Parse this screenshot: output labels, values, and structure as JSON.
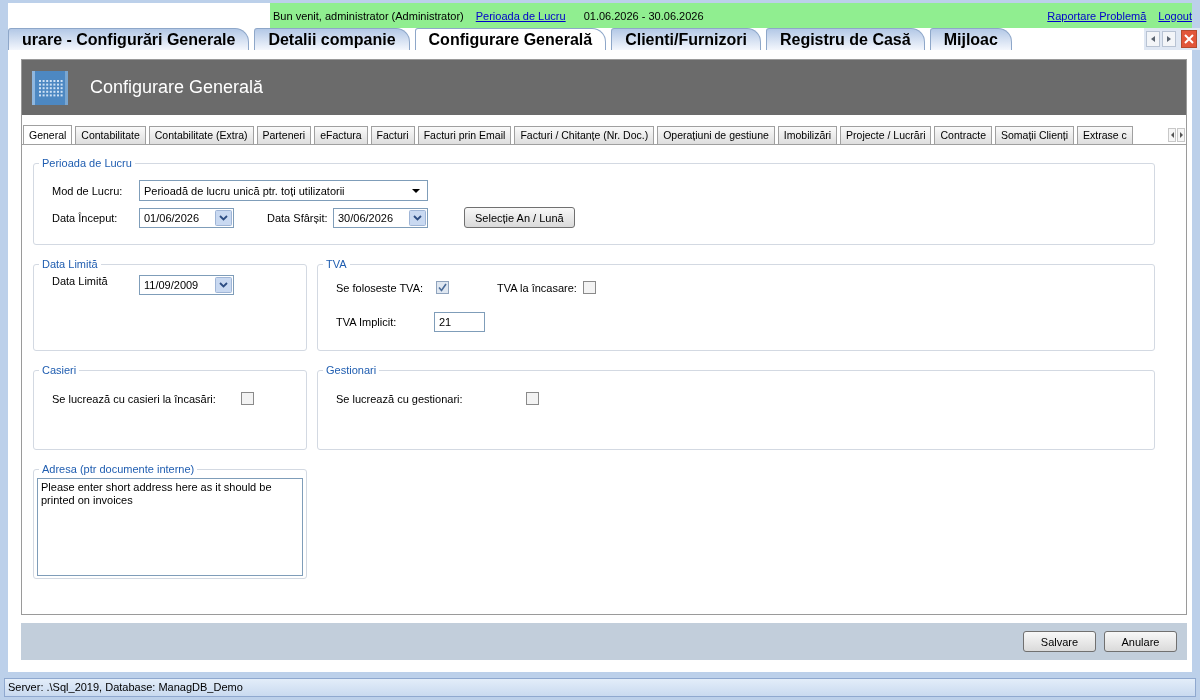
{
  "top_bar": {
    "welcome": "Bun venit, administrator (Administrator)",
    "period_link": "Perioada de Lucru",
    "period_range": "01.06.2026 - 30.06.2026",
    "links": [
      "Raportare Problemă",
      "Logout"
    ]
  },
  "module_tabs": [
    {
      "label": "urare - Configurări Generale",
      "selected": false
    },
    {
      "label": "Detalii companie",
      "selected": false
    },
    {
      "label": "Configurare Generală",
      "selected": true
    },
    {
      "label": "Clienti/Furnizori",
      "selected": false
    },
    {
      "label": "Registru de Casă",
      "selected": false
    },
    {
      "label": "Mijloac",
      "selected": false
    }
  ],
  "page_title": "Configurare Generală",
  "settings_tabs": [
    {
      "label": "General",
      "selected": true
    },
    {
      "label": "Contabilitate",
      "selected": false
    },
    {
      "label": "Contabilitate (Extra)",
      "selected": false
    },
    {
      "label": "Parteneri",
      "selected": false
    },
    {
      "label": "eFactura",
      "selected": false
    },
    {
      "label": "Facturi",
      "selected": false
    },
    {
      "label": "Facturi prin Email",
      "selected": false
    },
    {
      "label": "Facturi / Chitanțe (Nr. Doc.)",
      "selected": false
    },
    {
      "label": "Operațiuni de gestiune",
      "selected": false
    },
    {
      "label": "Imobilizări",
      "selected": false
    },
    {
      "label": "Projecte / Lucrări",
      "selected": false
    },
    {
      "label": "Contracte",
      "selected": false
    },
    {
      "label": "Somații Clienți",
      "selected": false
    },
    {
      "label": "Extrase c",
      "selected": false
    }
  ],
  "working_period": {
    "title": "Perioada de Lucru",
    "mode": {
      "label": "Mod de Lucru:",
      "value": "Perioadă de lucru unică ptr. toți utilizatorii"
    },
    "start": {
      "label": "Data Început:",
      "value": "01/06/2026"
    },
    "end": {
      "label": "Data Sfârșit:",
      "value": "30/06/2026"
    },
    "button": "Selecție An / Lună"
  },
  "deadline": {
    "title": "Data Limită",
    "label": "Data Limită",
    "value": "11/09/2009"
  },
  "vat": {
    "title": "TVA",
    "options": [
      {
        "label": "Se foloseste TVA:",
        "checked": true
      },
      {
        "label": "TVA la încasare:",
        "checked": false
      }
    ],
    "default_rate": {
      "label": "TVA Implicit:",
      "value": "21"
    }
  },
  "cashiers": {
    "title": "Casieri",
    "option": {
      "label": "Se lucrează cu casieri la încasări:",
      "checked": false
    }
  },
  "managers": {
    "title": "Gestionari",
    "option": {
      "label": "Se lucrează cu gestionari:",
      "checked": false
    }
  },
  "address": {
    "title": "Adresa (ptr documente interne)",
    "value": "Please enter short address here as it should be printed on invoices"
  },
  "buttons": [
    "Salvare",
    "Anulare"
  ],
  "status_bar": "Server: .\\Sql_2019, Database: ManagDB_Demo"
}
